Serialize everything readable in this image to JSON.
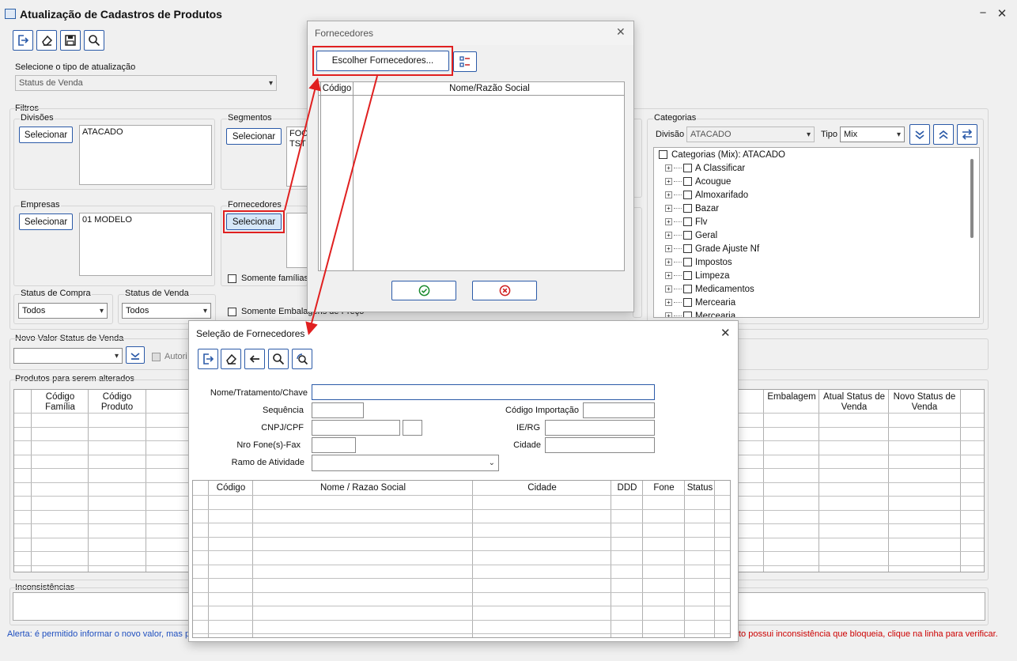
{
  "window": {
    "title": "Atualização de Cadastros de Produtos",
    "min": "−",
    "close": "✕"
  },
  "tipo": {
    "label": "Selecione o tipo de atualização",
    "value": "Status de Venda"
  },
  "filtros": {
    "label": "Filtros",
    "divisoes": {
      "label": "Divisões",
      "button": "Selecionar",
      "items": [
        "ATACADO"
      ]
    },
    "segmentos": {
      "label": "Segmentos",
      "button": "Selecionar",
      "items": [
        "FOO",
        "TST"
      ]
    },
    "empresas": {
      "label": "Empresas",
      "button": "Selecionar",
      "items": [
        "01 MODELO"
      ]
    },
    "fornecedores": {
      "label": "Fornecedores",
      "button": "Selecionar"
    },
    "somente_familias": "Somente famílias",
    "somente_embalagens": "Somente Embalagens de Preço",
    "status_compra": {
      "label": "Status de Compra",
      "value": "Todos"
    },
    "status_venda": {
      "label": "Status de Venda",
      "value": "Todos"
    }
  },
  "categorias": {
    "label": "Categorias",
    "divisao_label": "Divisão",
    "divisao_value": "ATACADO",
    "tipo_label": "Tipo",
    "tipo_value": "Mix",
    "root": "Categorias (Mix): ATACADO",
    "items": [
      "A Classificar",
      "Acougue",
      "Almoxarifado",
      "Bazar",
      "Flv",
      "Geral",
      "Grade Ajuste Nf",
      "Impostos",
      "Limpeza",
      "Medicamentos",
      "Mercearia",
      "Mercearia"
    ]
  },
  "novo_valor": {
    "label": "Novo Valor Status de Venda",
    "autori": "Autori"
  },
  "produtos": {
    "label": "Produtos para serem alterados",
    "headers_left": [
      "Código Família",
      "Código Produto"
    ],
    "headers_right": [
      "Embalagem",
      "Atual Status de Venda",
      "Novo Status de Venda"
    ]
  },
  "inconsistencias": {
    "label": "Inconsistências"
  },
  "alerta": {
    "left": "Alerta: é permitido informar o novo valor, mas po",
    "right": "to possui inconsistência que bloqueia, clique na linha para verificar."
  },
  "dlg_fornecedores": {
    "title": "Fornecedores",
    "choose_button": "Escolher Fornecedores...",
    "headers": [
      "Código",
      "Nome/Razão Social"
    ]
  },
  "dlg_selecao": {
    "title": "Seleção de Fornecedores",
    "labels": {
      "nome": "Nome/Tratamento/Chave",
      "sequencia": "Sequência",
      "codigo_importacao": "Código Importação",
      "cnpj": "CNPJ/CPF",
      "iergs": "IE/RG",
      "fone": "Nro Fone(s)-Fax",
      "cidade": "Cidade",
      "ramo": "Ramo de Atividade"
    },
    "headers": [
      "Código",
      "Nome / Razao Social",
      "Cidade",
      "DDD",
      "Fone",
      "Status"
    ]
  },
  "colors": {
    "accent": "#2b5aa8",
    "annotation": "#e02020",
    "alert_text": "#1f4fbf",
    "alert_red": "#cc0000"
  }
}
